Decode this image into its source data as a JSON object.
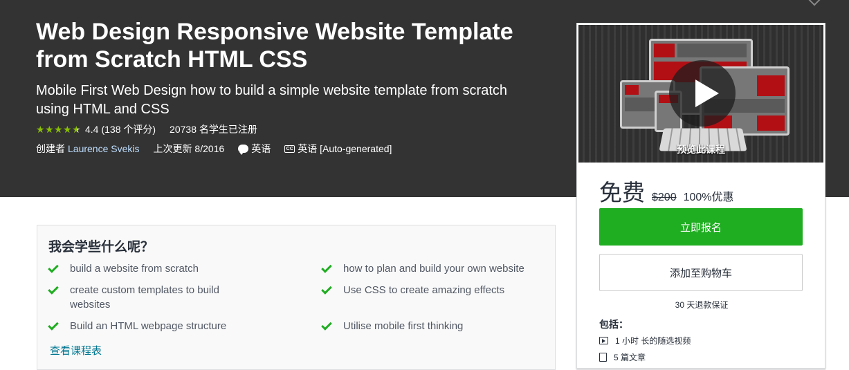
{
  "course": {
    "title": "Web Design Responsive Website Template from Scratch HTML CSS",
    "subtitle": "Mobile First Web Design how to build a simple website template from scratch using HTML and CSS",
    "rating_value": "4.4",
    "rating_count": "(138 个评分)",
    "enrolled": "20738 名学生已注册",
    "created_by_label": "创建者",
    "author": "Laurence Svekis",
    "updated": "上次更新 8/2016",
    "language": "英语",
    "captions": "英语 [Auto-generated]"
  },
  "sidebar": {
    "preview_label": "预览此课程",
    "price": "免费",
    "original_price": "$200",
    "discount": "100%优惠",
    "enroll_label": "立即报名",
    "cart_label": "添加至购物车",
    "guarantee": "30 天退款保证",
    "includes_title": "包括：",
    "includes": [
      {
        "icon": "video-icon",
        "label": "1 小时 长的随选视频"
      },
      {
        "icon": "document-icon",
        "label": "5 篇文章"
      }
    ]
  },
  "learn": {
    "title": "我会学些什么呢？",
    "items": [
      "build a website from scratch",
      "how to plan and build your own website",
      "create custom templates to build websites",
      "Use CSS to create amazing effects",
      "Build an HTML webpage structure",
      "Utilise mobile first thinking"
    ],
    "curriculum_link": "查看课程表"
  },
  "colors": {
    "hero_bg": "#333333",
    "accent_green": "#1fad21",
    "star": "#8ac200",
    "link": "#007791"
  }
}
